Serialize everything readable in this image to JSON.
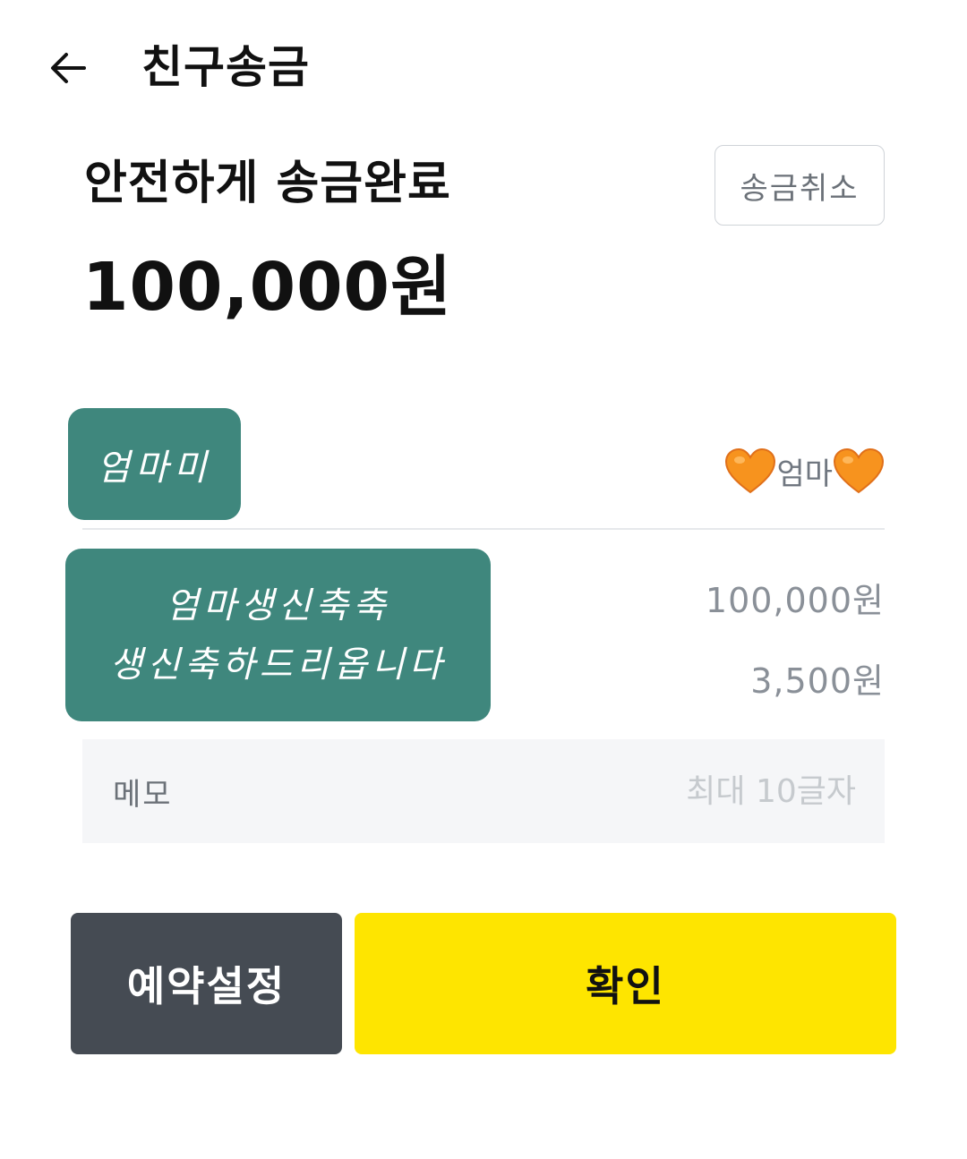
{
  "header": {
    "back_icon": "arrow-left-icon",
    "title": "친구송금"
  },
  "status": {
    "title": "안전하게 송금완료",
    "amount": "100,000원",
    "cancel_label": "송금취소"
  },
  "recipient": {
    "sticker_text": "엄마미",
    "heart_icon": "orange-heart-icon",
    "heart_color": "#f7931e",
    "name": "엄마"
  },
  "message": {
    "sticker_line1": "엄마생신축축",
    "sticker_line2": "생신축하드리옵니다",
    "sticker_color": "#3f877d"
  },
  "amounts": {
    "send_amount": "100,000원",
    "fee": "3,500원"
  },
  "memo": {
    "label": "메모",
    "value": "",
    "placeholder": "최대 10글자"
  },
  "buttons": {
    "schedule_label": "예약설정",
    "confirm_label": "확인",
    "confirm_color": "#fee500",
    "schedule_color": "#454b53"
  }
}
